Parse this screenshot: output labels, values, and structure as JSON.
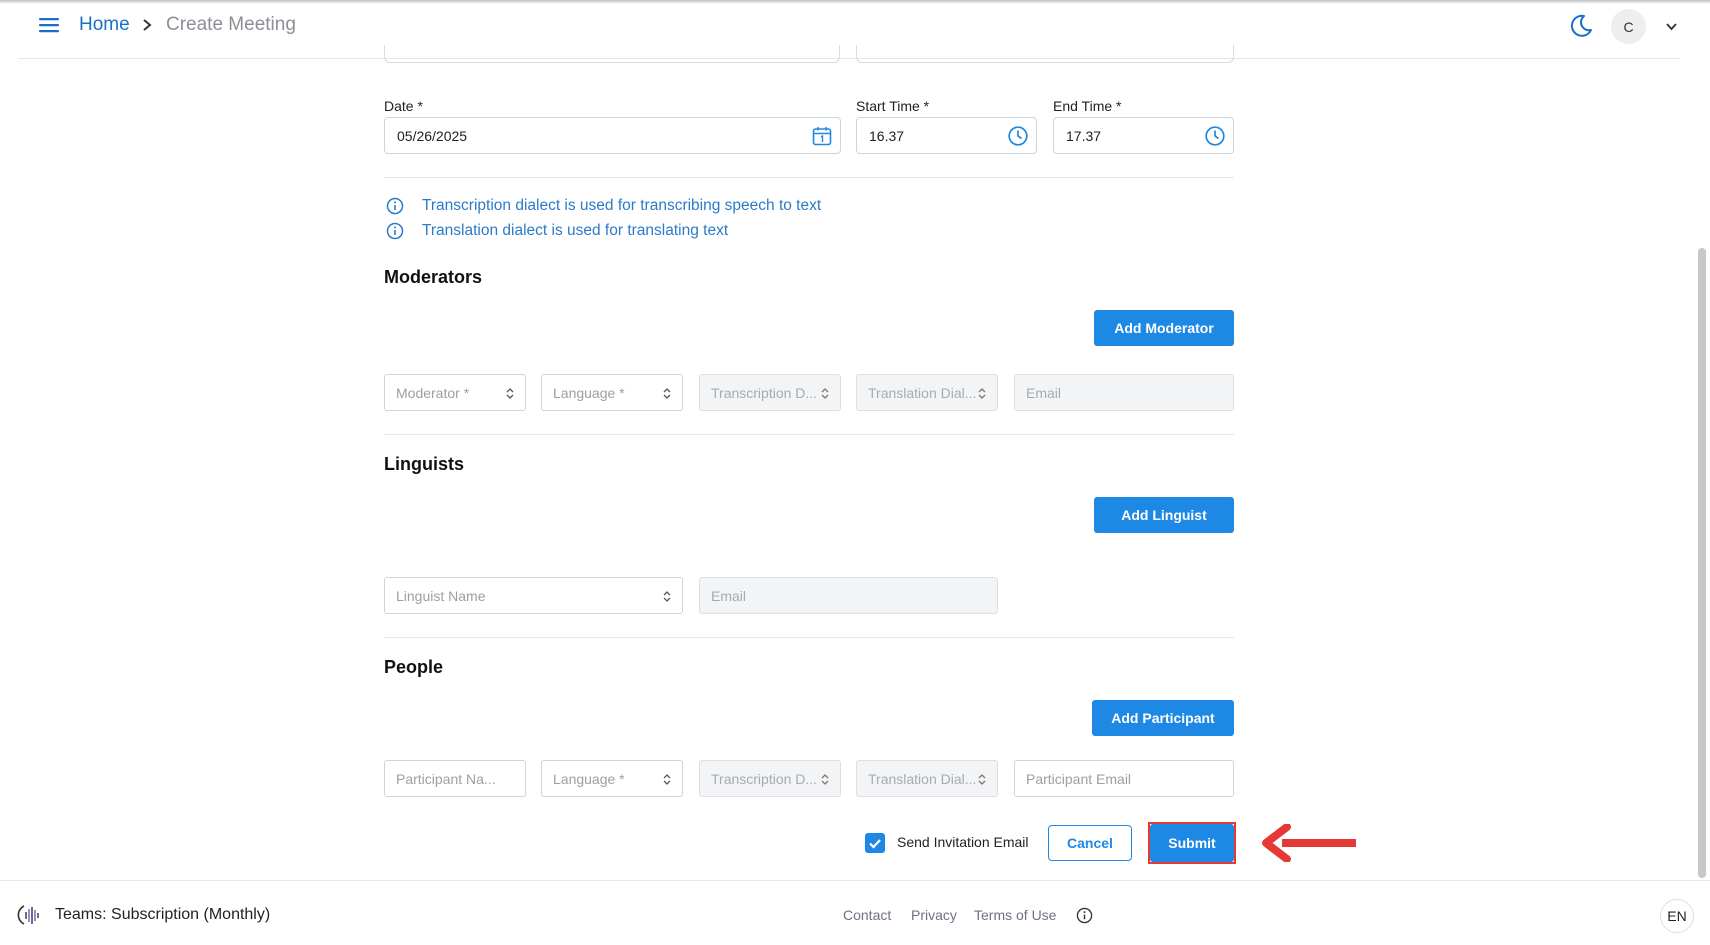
{
  "header": {
    "home": "Home",
    "current": "Create Meeting",
    "avatar_initial": "C"
  },
  "form": {
    "date": {
      "label": "Date *",
      "value": "05/26/2025"
    },
    "start_time": {
      "label": "Start Time *",
      "value": "16.37"
    },
    "end_time": {
      "label": "End Time *",
      "value": "17.37"
    },
    "info_lines": [
      "Transcription dialect is used for transcribing speech to text",
      "Translation dialect is used for translating text"
    ]
  },
  "moderators": {
    "title": "Moderators",
    "add_button": "Add Moderator",
    "fields": {
      "moderator": "Moderator *",
      "language": "Language *",
      "transcription": "Transcription D...",
      "translation": "Translation Dial...",
      "email": "Email"
    }
  },
  "linguists": {
    "title": "Linguists",
    "add_button": "Add Linguist",
    "fields": {
      "name": "Linguist Name",
      "email": "Email"
    }
  },
  "people": {
    "title": "People",
    "add_button": "Add Participant",
    "fields": {
      "name": "Participant Na...",
      "language": "Language *",
      "transcription": "Transcription D...",
      "translation": "Translation Dial...",
      "email": "Participant Email"
    }
  },
  "actions": {
    "send_invitation": "Send Invitation Email",
    "send_invitation_checked": true,
    "cancel": "Cancel",
    "submit": "Submit"
  },
  "footer": {
    "team": "Teams: Subscription (Monthly)",
    "links": [
      "Contact",
      "Privacy",
      "Terms of Use"
    ],
    "language": "EN"
  },
  "colors": {
    "primary": "#1e88e5",
    "link": "#1b6fc8",
    "highlight": "#e53935"
  }
}
